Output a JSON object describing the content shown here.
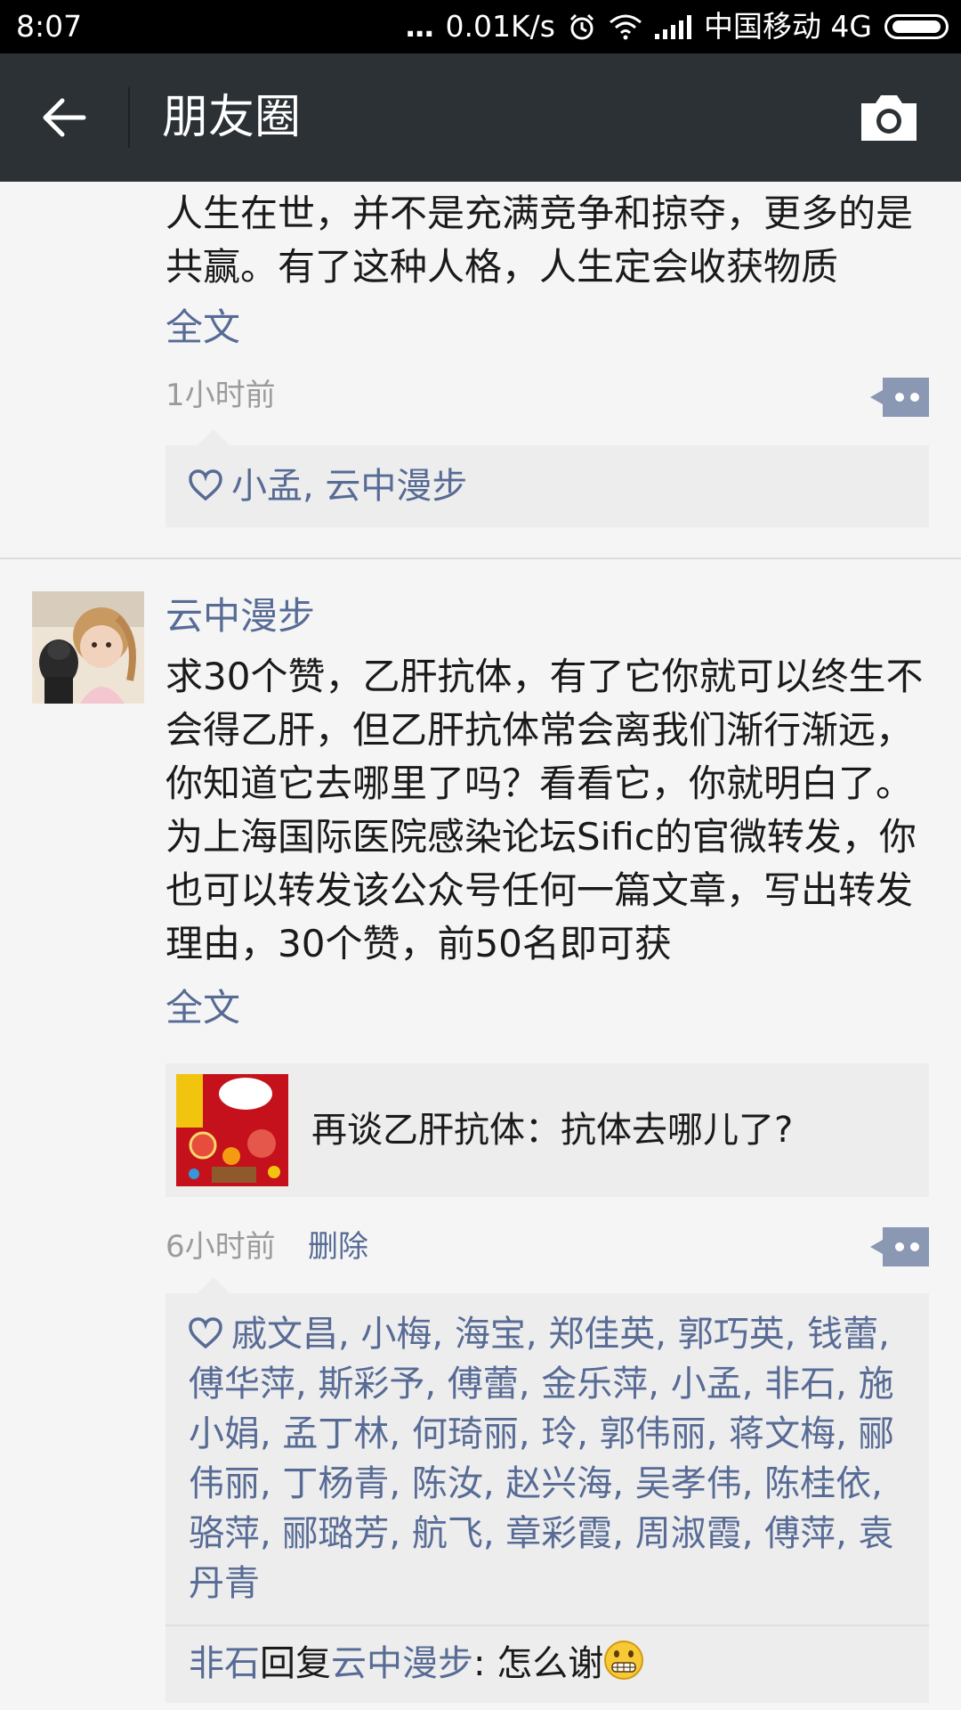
{
  "status_bar": {
    "time": "8:07",
    "dots": "...",
    "speed": "0.01K/s",
    "carrier": "中国移动 4G",
    "icons": [
      "alarm-icon",
      "wifi-icon",
      "signal-icon",
      "battery-icon"
    ]
  },
  "nav": {
    "title": "朋友圈",
    "back_icon": "back-arrow-icon",
    "camera_icon": "camera-icon"
  },
  "colors": {
    "link": "#576b95",
    "navbar": "#2b3135",
    "background": "#f5f5f6",
    "like_box": "#ededed"
  },
  "post1": {
    "text": "人生在世，并不是充满竞争和掠夺，更多的是共赢。有了这种人格，人生定会收获物质",
    "fulltext_label": "全文",
    "time": "1小时前",
    "likes": "小孟, 云中漫步"
  },
  "post2": {
    "username": "云中漫步",
    "text": "求30个赞，乙肝抗体，有了它你就可以终生不会得乙肝，但乙肝抗体常会离我们渐行渐远，你知道它去哪里了吗？看看它，你就明白了。为上海国际医院感染论坛Sific的官微转发，你也可以转发该公众号任何一篇文章，写出转发理由，30个赞，前50名即可获",
    "fulltext_label": "全文",
    "share_title": "再谈乙肝抗体：抗体去哪儿了?",
    "time": "6小时前",
    "delete_label": "删除",
    "likes": "戚文昌, 小梅, 海宝, 郑佳英, 郭巧英, 钱蕾, 傅华萍, 斯彩予, 傅蕾, 金乐萍, 小孟, 非石, 施小娟, 孟丁林, 何琦丽, 玲, 郭伟丽, 蒋文梅, 郦伟丽, 丁杨青, 陈汝, 赵兴海, 吴孝伟, 陈桂依, 骆萍, 郦璐芳, 航飞, 章彩霞, 周淑霞, 傅萍, 袁丹青",
    "comment": {
      "from": "非石",
      "reply_word": "回复",
      "to": "云中漫步",
      "text": ": 怎么谢",
      "emoji": "grimace-emoji"
    }
  }
}
